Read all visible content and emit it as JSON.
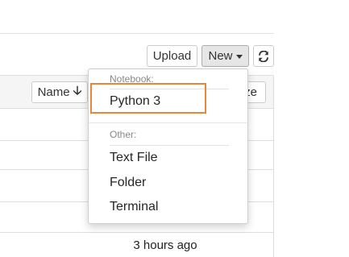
{
  "toolbar": {
    "upload_label": "Upload",
    "new_label": "New",
    "refresh_icon": "refresh-icon"
  },
  "list": {
    "sort_name_label": "Name",
    "sort_icon": "arrow-down-icon",
    "size_label_partial": "ze",
    "rows": [
      {
        "time": ""
      },
      {
        "time": ""
      },
      {
        "time": ""
      },
      {
        "time": ""
      },
      {
        "time": "3 hours ago"
      }
    ]
  },
  "new_menu": {
    "notebook_header": "Notebook:",
    "notebook_items": [
      "Python 3"
    ],
    "other_header": "Other:",
    "other_items": [
      "Text File",
      "Folder",
      "Terminal"
    ]
  },
  "colors": {
    "highlight": "#e8873a",
    "header_text": "#888888"
  }
}
